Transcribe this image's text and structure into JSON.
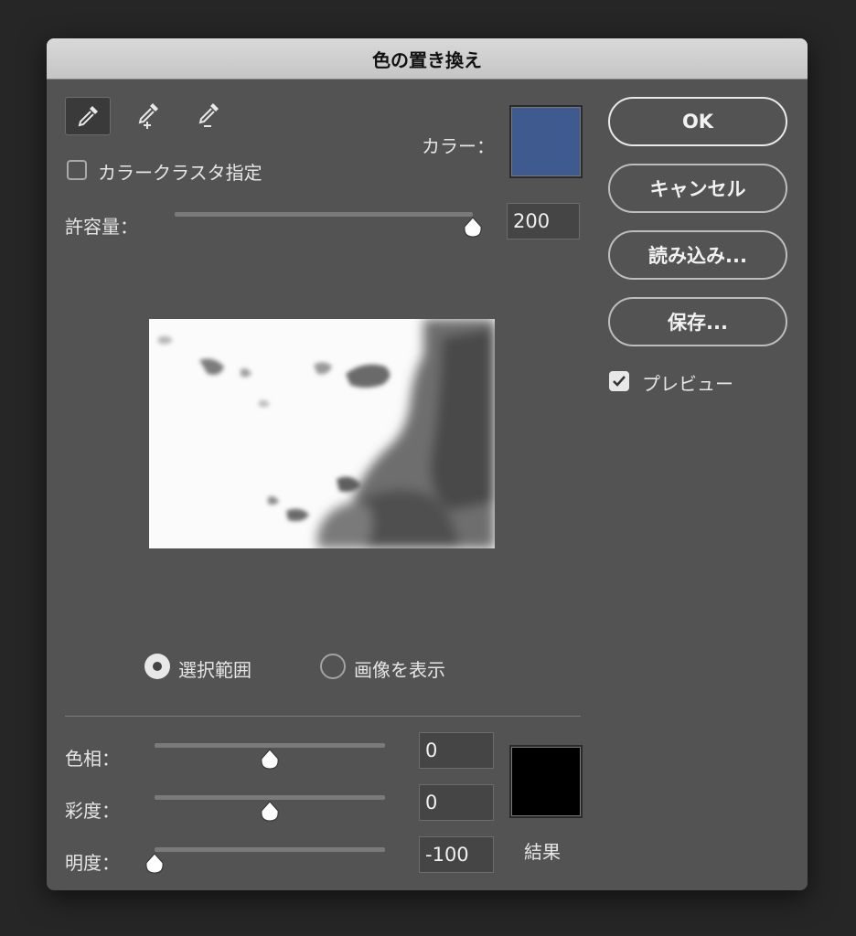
{
  "dialog": {
    "title": "色の置き換え"
  },
  "tools": {
    "eyedropper": "eyedropper-icon",
    "eyedropper_add": "eyedropper-plus-icon",
    "eyedropper_subtract": "eyedropper-minus-icon"
  },
  "selection": {
    "color_label": "カラー：",
    "color_value": "#3e5a8f",
    "cluster_label": "カラークラスタ指定",
    "cluster_checked": false,
    "tolerance_label": "許容量：",
    "tolerance_value": "200",
    "tolerance_fraction": 1.0
  },
  "view": {
    "selection_label": "選択範囲",
    "image_label": "画像を表示",
    "selected": "selection"
  },
  "replacement": {
    "hue_label": "色相：",
    "hue_value": "0",
    "hue_fraction": 0.5,
    "saturation_label": "彩度：",
    "saturation_value": "0",
    "saturation_fraction": 0.5,
    "lightness_label": "明度：",
    "lightness_value": "-100",
    "lightness_fraction": 0.0,
    "result_label": "結果",
    "result_color": "#000000"
  },
  "buttons": {
    "ok": "OK",
    "cancel": "キャンセル",
    "load": "読み込み...",
    "save": "保存..."
  },
  "preview_toggle": {
    "label": "プレビュー",
    "checked": true
  }
}
